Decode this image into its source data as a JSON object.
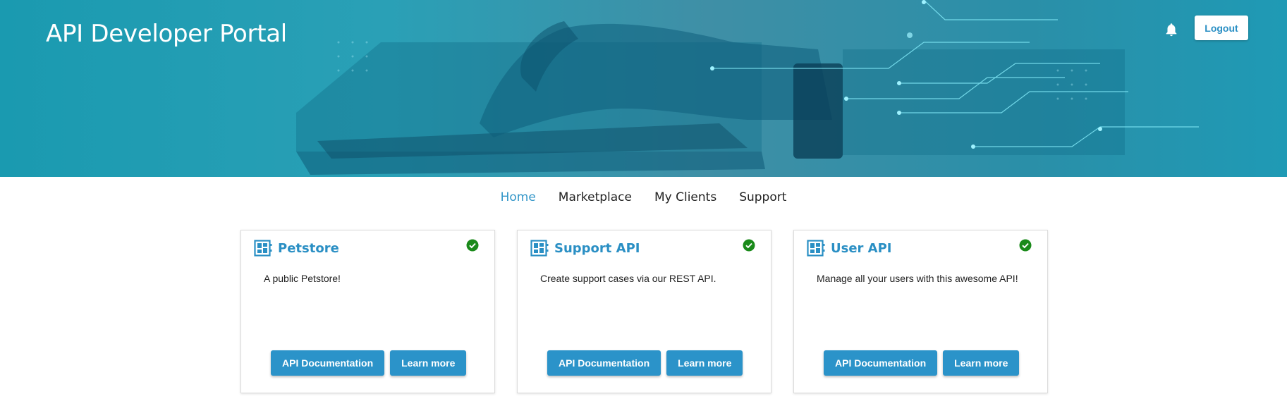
{
  "header": {
    "title": "API Developer Portal",
    "bell_icon": "bell-icon",
    "logout_label": "Logout"
  },
  "nav": {
    "items": [
      {
        "label": "Home",
        "active": true
      },
      {
        "label": "Marketplace",
        "active": false
      },
      {
        "label": "My Clients",
        "active": false
      },
      {
        "label": "Support",
        "active": false
      }
    ]
  },
  "cards": [
    {
      "title": "Petstore",
      "description": "A public Petstore!",
      "status_icon": "check-circle-icon",
      "doc_label": "API Documentation",
      "learn_label": "Learn more"
    },
    {
      "title": "Support API",
      "description": "Create support cases via our REST API.",
      "status_icon": "check-circle-icon",
      "doc_label": "API Documentation",
      "learn_label": "Learn more"
    },
    {
      "title": "User API",
      "description": "Manage all your users with this awesome API!",
      "status_icon": "check-circle-icon",
      "doc_label": "API Documentation",
      "learn_label": "Learn more"
    }
  ],
  "colors": {
    "brand": "#2a8fc4",
    "active_nav": "#3296c8",
    "status_ok": "#1a8a1a",
    "hero": "#1a9ab0"
  }
}
